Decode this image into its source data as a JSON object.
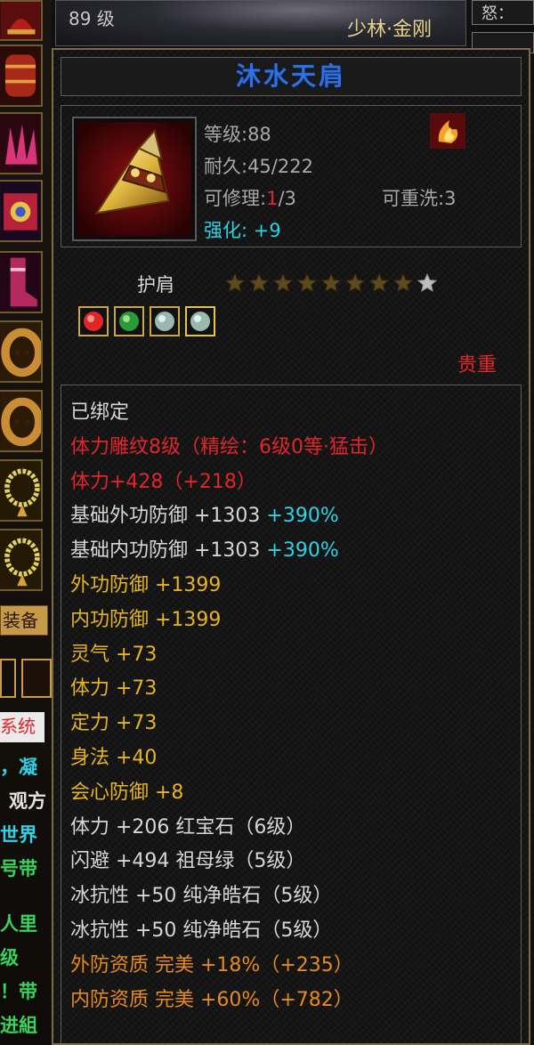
{
  "top": {
    "level": "89 级",
    "faction": "少林·金刚",
    "right_label": "怒："
  },
  "left_strip": {
    "tab_label": "装备",
    "side_fragments": [
      "系统",
      "，凝",
      "观方",
      "世界",
      "号带",
      "人里",
      "级",
      "！带",
      "进組"
    ]
  },
  "item": {
    "name": "沐水天肩",
    "icon": "golden-shoulder-armor",
    "level": "等级:88",
    "durability": "耐久:45/222",
    "repair_label": "可修理:",
    "repair_current": "1",
    "repair_total": "/3",
    "reroll": "可重洗:3",
    "enhance_label": "强化:",
    "enhance_value": "+9",
    "buff_icon": "flame-buff-icon",
    "slot_type": "护肩",
    "star_total": 9,
    "stars_filled": 8,
    "gems": [
      "red-gem",
      "green-gem",
      "white-gem",
      "white-gem"
    ],
    "rarity": "贵重"
  },
  "stats": [
    {
      "text": "已绑定",
      "color": "#d6d6d6"
    },
    {
      "text": "体力雕纹8级（精绘：6级0等·猛击）",
      "color": "#e0262a"
    },
    {
      "text": "体力+428（+218）",
      "color": "#e0262a"
    },
    {
      "text": "基础外功防御 +1303 ",
      "extra": "+390%",
      "color": "#d6d6d6"
    },
    {
      "text": "基础内功防御 +1303 ",
      "extra": "+390%",
      "color": "#d6d6d6"
    },
    {
      "text": "外功防御 +1399",
      "color": "#e6b422"
    },
    {
      "text": "内功防御 +1399",
      "color": "#e6b422"
    },
    {
      "text": "灵气 +73",
      "color": "#e6b422"
    },
    {
      "text": "体力 +73",
      "color": "#e6b422"
    },
    {
      "text": "定力 +73",
      "color": "#e6b422"
    },
    {
      "text": "身法 +40",
      "color": "#e6b422"
    },
    {
      "text": "会心防御 +8",
      "color": "#e6b422"
    },
    {
      "text": "体力 +206 红宝石（6级）",
      "color": "#d6d6d6"
    },
    {
      "text": "闪避 +494 祖母绿（5级）",
      "color": "#d6d6d6"
    },
    {
      "text": "冰抗性 +50 纯净皓石（5级）",
      "color": "#d6d6d6"
    },
    {
      "text": "冰抗性 +50 纯净皓石（5级）",
      "color": "#d6d6d6"
    },
    {
      "text": "外防资质  完美 +18%（+235）",
      "color": "#e68a1e"
    },
    {
      "text": "内防资质  完美 +60%（+782）",
      "color": "#e68a1e"
    }
  ],
  "colors": {
    "title": "#2f6fe0",
    "red": "#e0262a",
    "cyan": "#2fd3e6",
    "gold": "#e6b422",
    "orange": "#e68a1e"
  }
}
